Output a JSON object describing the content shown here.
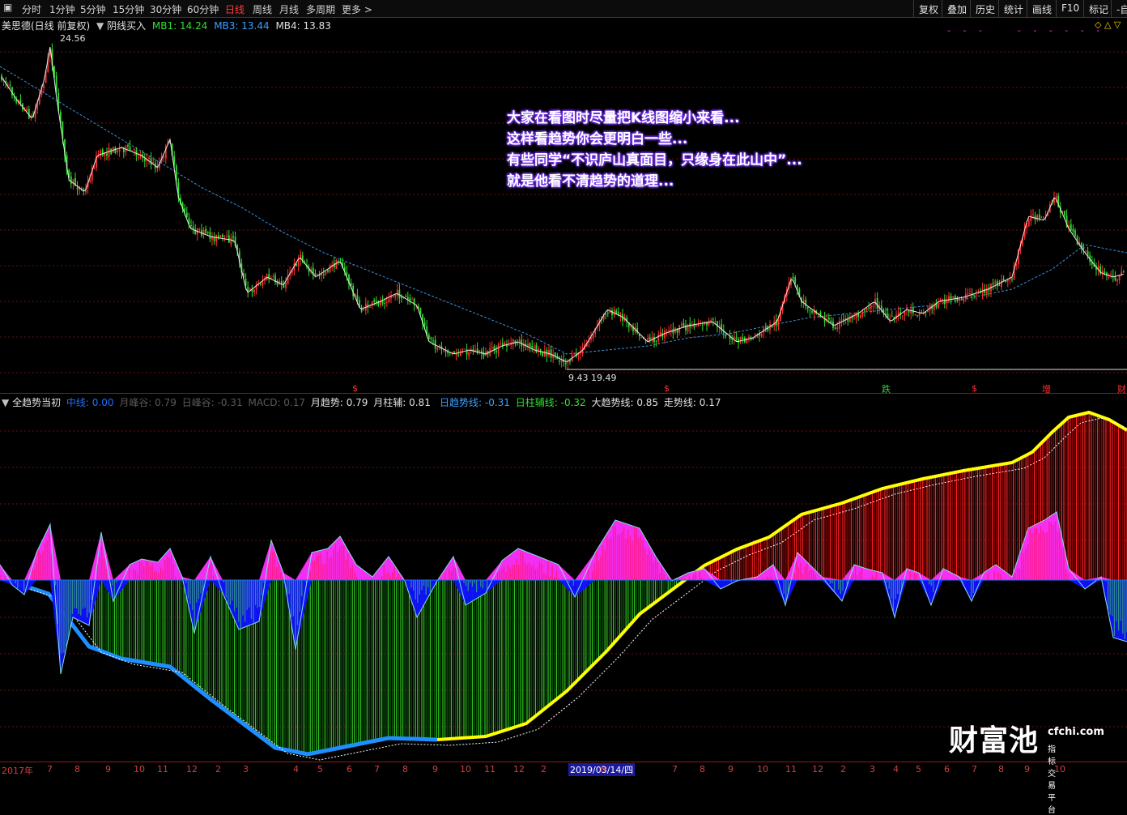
{
  "toolbar": {
    "periods": [
      "分时",
      "1分钟",
      "5分钟",
      "15分钟",
      "30分钟",
      "60分钟",
      "日线",
      "周线",
      "月线",
      "多周期",
      "更多 >"
    ],
    "active_period": "日线",
    "right_buttons": [
      "复权",
      "叠加",
      "历史",
      "统计",
      "画线",
      "F10",
      "标记",
      "-自"
    ]
  },
  "main_header": {
    "stock": "美思德(日线 前复权)",
    "indicator": "阴线买入",
    "mb1": "MB1: 14.24",
    "mb3": "MB3: 13.44",
    "mb4": "MB4: 13.83",
    "high_label": "24.56",
    "low_label": "9.43",
    "low_label2": "19.49"
  },
  "annotation": {
    "lines": [
      "大家在看图时尽量把K线图缩小来看...",
      "这样看趋势你会更明白一些...",
      "有些同学“不识庐山真面目，只缘身在此山中”...",
      "就是他看不清趋势的道理..."
    ]
  },
  "markers": [
    {
      "text": "$",
      "color": "#ff3030"
    },
    {
      "text": "$",
      "color": "#ff3030"
    },
    {
      "text": "跌",
      "color": "#30d030"
    },
    {
      "text": "$",
      "color": "#ff3030"
    },
    {
      "text": "增",
      "color": "#ff3030"
    },
    {
      "text": "财",
      "color": "#ff3030"
    }
  ],
  "sub_header": {
    "title": "全趋势当初",
    "zhongxian": "中线: 0.00",
    "yuefengge": "月峰谷: 0.79",
    "rifengge": "日峰谷: -0.31",
    "macd": "MACD: 0.17",
    "yuequshi": "月趋势: 0.79",
    "yuezhufu": "月柱辅: 0.81",
    "riqushi": "日趋势线: -0.31",
    "rizhufu": "日柱辅线: -0.32",
    "daqushi": "大趋势线: 0.85",
    "zoushi": "走势线: 0.17"
  },
  "time_axis": [
    "2017年",
    "7",
    "8",
    "9",
    "10",
    "11",
    "12",
    "2",
    "3",
    "4",
    "5",
    "6",
    "7",
    "8",
    "9",
    "10",
    "11",
    "12",
    "2",
    "2019/03/14/四",
    "6",
    "7",
    "8",
    "9",
    "10",
    "11",
    "12",
    "2",
    "3",
    "4",
    "5",
    "6",
    "7",
    "8",
    "9",
    "10"
  ],
  "watermark": {
    "brand": "财富池",
    "url": "cfchi.com",
    "slogan": "指标交易平台"
  },
  "colors": {
    "up": "#ff3030",
    "down": "#30e030",
    "ma": "#e8e8e8",
    "ma_long": "#3a8fe0",
    "trend_yellow": "#ffff00",
    "trend_blue": "#1e8fff",
    "pink": "#ff1a8c",
    "magenta": "#ff30ff",
    "teal": "#2e8b8b"
  }
}
